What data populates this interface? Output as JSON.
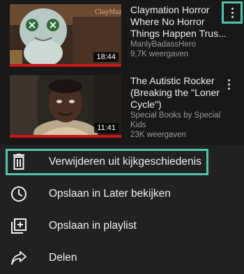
{
  "videos": [
    {
      "title": "Claymation Horror\nWhere No Horror\nThings Happen Trus...",
      "channel": "ManlyBadassHero",
      "views": "9,7K weergaven",
      "duration": "18:44",
      "thumbnail_text": "ClayMan"
    },
    {
      "title": "The Autistic Rocker\n(Breaking the \"Loner\nCycle\")",
      "channel": "Special Books by Special Kids",
      "views": "23K weergaven",
      "duration": "11:41"
    }
  ],
  "menu": [
    {
      "label": "Verwijderen uit kijkgeschiedenis",
      "icon": "trash-icon"
    },
    {
      "label": "Opslaan in Later bekijken",
      "icon": "clock-icon"
    },
    {
      "label": "Opslaan in playlist",
      "icon": "playlist-add-icon"
    },
    {
      "label": "Delen",
      "icon": "share-icon"
    }
  ],
  "colors": {
    "highlight": "#4fc6a6",
    "progress": "#cc1616",
    "menu_bg": "#212121"
  }
}
